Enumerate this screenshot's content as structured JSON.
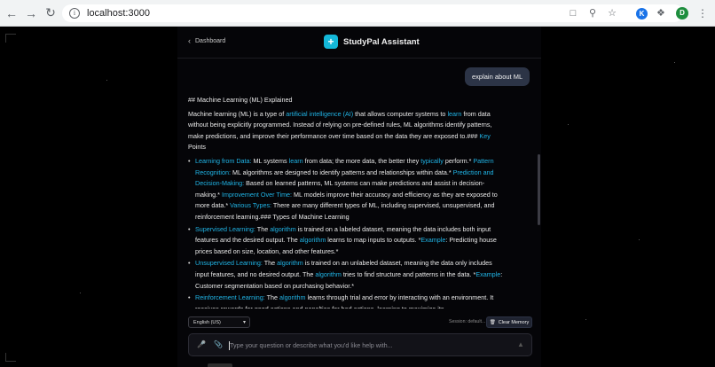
{
  "browser": {
    "url": "localhost:3000",
    "extension_letter": "K",
    "profile_letter": "D"
  },
  "header": {
    "back_label": "Dashboard",
    "title": "StudyPal Assistant"
  },
  "user_message": "explain about ML",
  "assistant": {
    "heading": "## Machine Learning (ML) Explained",
    "intro": [
      {
        "t": "Machine learning (ML) is a type of ",
        "hl": false
      },
      {
        "t": "artificial intelligence (AI)",
        "hl": true
      },
      {
        "t": " that allows computer systems to ",
        "hl": false
      },
      {
        "t": "learn",
        "hl": true
      },
      {
        "t": " from data without being explicitly programmed. Instead of relying on pre-defined rules, ML algorithms identify patterns, make predictions, and improve their performance over time based on the data they are exposed to.### ",
        "hl": false
      },
      {
        "t": "Key",
        "hl": true
      },
      {
        "t": " Points",
        "hl": false
      }
    ],
    "bullets": [
      [
        {
          "t": "Learning from Data:",
          "hl": true
        },
        {
          "t": " ML systems ",
          "hl": false
        },
        {
          "t": "learn",
          "hl": true
        },
        {
          "t": " from data; the more data, the better they ",
          "hl": false
        },
        {
          "t": "typically",
          "hl": true
        },
        {
          "t": " perform.* ",
          "hl": false
        },
        {
          "t": "Pattern Recognition:",
          "hl": true
        },
        {
          "t": " ML algorithms are designed to identify patterns and relationships within data.* ",
          "hl": false
        },
        {
          "t": "Prediction and Decision-Making:",
          "hl": true
        },
        {
          "t": " Based on learned patterns, ML systems can make predictions and assist in decision-making.* ",
          "hl": false
        },
        {
          "t": "Improvement Over Time:",
          "hl": true
        },
        {
          "t": " ML models improve their accuracy and efficiency as they are exposed to more data.* ",
          "hl": false
        },
        {
          "t": "Various Types:",
          "hl": true
        },
        {
          "t": " There are many different types of ML, including supervised, unsupervised, and reinforcement learning.### Types of Machine Learning",
          "hl": false
        }
      ],
      [
        {
          "t": "Supervised Learning:",
          "hl": true
        },
        {
          "t": " The ",
          "hl": false
        },
        {
          "t": "algorithm",
          "hl": true
        },
        {
          "t": " is trained on a labeled dataset, meaning the data includes both input features and the desired output. The ",
          "hl": false
        },
        {
          "t": "algorithm",
          "hl": true
        },
        {
          "t": " learns to map inputs to outputs. *",
          "hl": false
        },
        {
          "t": "Example",
          "hl": true
        },
        {
          "t": ": Predicting house prices based on size, location, and other features.*",
          "hl": false
        }
      ],
      [
        {
          "t": "Unsupervised Learning:",
          "hl": true
        },
        {
          "t": " The ",
          "hl": false
        },
        {
          "t": "algorithm",
          "hl": true
        },
        {
          "t": " is trained on an unlabeled dataset, meaning the data only includes input features, and no desired output. The ",
          "hl": false
        },
        {
          "t": "algorithm",
          "hl": true
        },
        {
          "t": " tries to find structure and patterns in the data. *",
          "hl": false
        },
        {
          "t": "Example",
          "hl": true
        },
        {
          "t": ": Customer segmentation based on purchasing behavior.*",
          "hl": false
        }
      ],
      [
        {
          "t": "Reinforcement Learning:",
          "hl": true
        },
        {
          "t": " The ",
          "hl": false
        },
        {
          "t": "algorithm",
          "hl": true
        },
        {
          "t": " learns through trial and error by interacting with an environment. It receives rewards for good actions and penalties for bad actions, learning to maximize its",
          "hl": false
        }
      ]
    ]
  },
  "toolbar": {
    "language": "English (US)",
    "session_text": "Session: default...",
    "clear_label": "Clear Memory"
  },
  "input": {
    "placeholder": "Type your question or describe what you'd like help with..."
  },
  "colors": {
    "accent": "#20b4e6",
    "logo": "#14b8d9",
    "user_bubble": "#2c3446"
  },
  "icons": {
    "back": "chevron-left-icon",
    "logo": "plus-icon",
    "mic": "microphone-icon",
    "attach": "paperclip-icon",
    "send": "send-icon",
    "clear": "trash-icon"
  }
}
